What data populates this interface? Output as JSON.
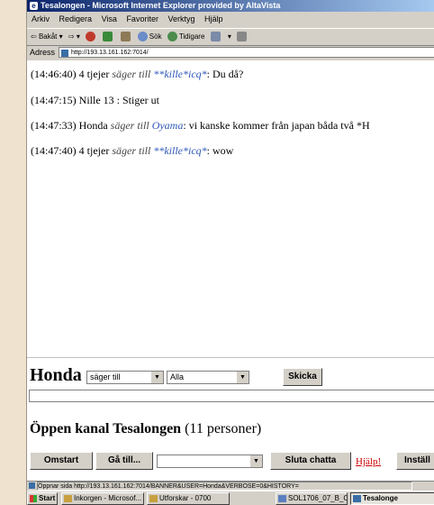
{
  "window": {
    "title": "Tesalongen - Microsoft Internet Explorer provided by AltaVista"
  },
  "menu": [
    "Arkiv",
    "Redigera",
    "Visa",
    "Favoriter",
    "Verktyg",
    "Hjälp"
  ],
  "toolbar": {
    "back": "Bakåt",
    "search": "Sök",
    "history": "Tidigare"
  },
  "address": {
    "label": "Adress",
    "url": "http://193.13.161.162:7014/"
  },
  "messages": [
    {
      "time": "(14:46:40)",
      "from": "4 tjejer",
      "verb": "säger till",
      "to": "**kille*icq*",
      "text": ": Du då?"
    },
    {
      "time": "(14:47:15)",
      "from": "Nille 13",
      "verb": "",
      "to": "",
      "text": " : Stiger ut"
    },
    {
      "time": "(14:47:33)",
      "from": "Honda",
      "verb": "säger till",
      "to": "Oyama",
      "text": ": vi kanske kommer från japan båda två *H"
    },
    {
      "time": "(14:47:40)",
      "from": "4 tjejer",
      "verb": "säger till",
      "to": "**kille*icq*",
      "text": ": wow"
    }
  ],
  "compose": {
    "sender": "Honda",
    "mode_value": "säger till",
    "recipient_value": "Alla",
    "send_label": "Skicka",
    "message_value": ""
  },
  "channel": {
    "title": "Öppen kanal Tesalongen",
    "count": "(11 personer)"
  },
  "actions": {
    "restart": "Omstart",
    "goto": "Gå till...",
    "goto_value": "",
    "stop": "Sluta chatta",
    "help": "Hjälp!",
    "settings": "Inställ"
  },
  "status": {
    "text": "Öppnar sida http://193.13.161.162:7014/BANNER&USER=Honda&VERBOSE=0&HISTORY="
  },
  "taskbar": {
    "start": "Start",
    "tasks": [
      "Inkorgen - Microsof...",
      "Utforskar - 0700",
      "SOL1706_07_B_C...",
      "Tesalonge"
    ]
  },
  "colors": {
    "titlebar": "#0a246a",
    "nick": "#2f57b8",
    "help_link": "#cc0000",
    "desktop": "#efe2cf"
  }
}
